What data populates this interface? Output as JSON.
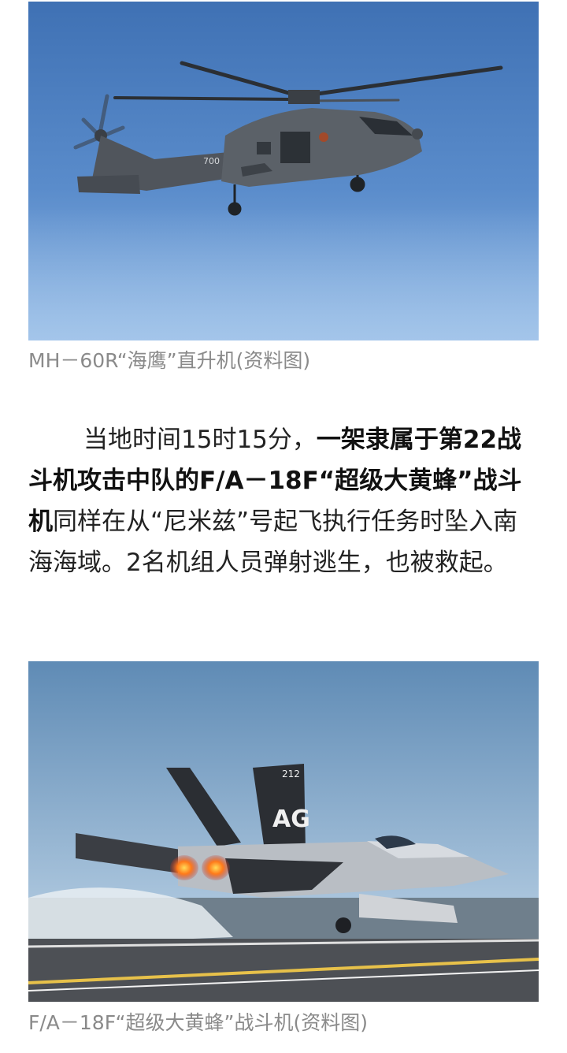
{
  "figures": [
    {
      "caption": "MH－60R“海鹰”直升机(资料图)"
    },
    {
      "caption": "F/A－18F“超级大黄蜂”战斗机(资料图)"
    }
  ],
  "article": {
    "p1_lead": "当地时间15时15分，",
    "p1_bold": "一架隶属于第22战斗机攻击中队的F/A－18F“超级大黄蜂”战斗机",
    "p1_rest": "同样在从“尼米兹”号起飞执行任务时坠入南海海域。2名机组人员弹射逃生，也被救起。"
  },
  "markings": {
    "heli_tail_number": "700",
    "jet_tail_letters": "AG",
    "jet_number": "212"
  }
}
